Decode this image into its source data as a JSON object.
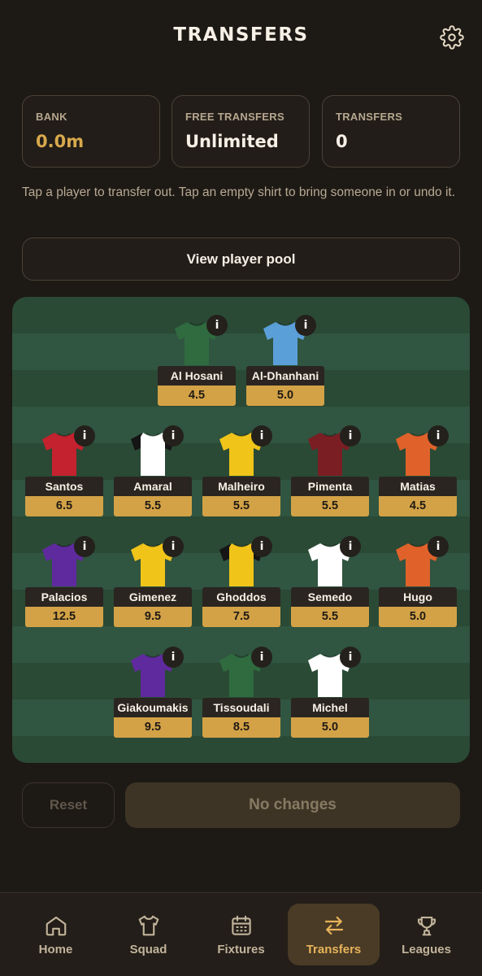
{
  "header": {
    "title": "TRANSFERS",
    "settings_icon": "gear-icon"
  },
  "stats": [
    {
      "label": "BANK",
      "value": "0.0m"
    },
    {
      "label": "FREE TRANSFERS",
      "value": "Unlimited"
    },
    {
      "label": "TRANSFERS",
      "value": "0"
    }
  ],
  "hint": "Tap a player to transfer out. Tap an empty shirt to bring someone in or undo it.",
  "pool_button": "View player pool",
  "info_glyph": "i",
  "players": [
    {
      "name": "Al Hosani",
      "price": "4.5",
      "color": "#2f6b3f",
      "sleeve": "#2f6b3f"
    },
    {
      "name": "Al-Dhanhani",
      "price": "5.0",
      "color": "#5b9fd9",
      "sleeve": "#5b9fd9"
    },
    {
      "name": "Santos",
      "price": "6.5",
      "color": "#c4222e",
      "sleeve": "#c4222e"
    },
    {
      "name": "Amaral",
      "price": "5.5",
      "color": "#ffffff",
      "sleeve": "#151515"
    },
    {
      "name": "Malheiro",
      "price": "5.5",
      "color": "#f0c419",
      "sleeve": "#f0c419"
    },
    {
      "name": "Pimenta",
      "price": "5.5",
      "color": "#7a1e24",
      "sleeve": "#7a1e24"
    },
    {
      "name": "Matias",
      "price": "4.5",
      "color": "#e0622a",
      "sleeve": "#e0622a"
    },
    {
      "name": "Palacios",
      "price": "12.5",
      "color": "#5f2a9e",
      "sleeve": "#5f2a9e"
    },
    {
      "name": "Gimenez",
      "price": "9.5",
      "color": "#f0c419",
      "sleeve": "#f0c419"
    },
    {
      "name": "Ghoddos",
      "price": "7.5",
      "color": "#f0c419",
      "sleeve": "#151515"
    },
    {
      "name": "Semedo",
      "price": "5.5",
      "color": "#ffffff",
      "sleeve": "#ffffff"
    },
    {
      "name": "Hugo",
      "price": "5.0",
      "color": "#e0622a",
      "sleeve": "#e0622a"
    },
    {
      "name": "Giakoumakis",
      "price": "9.5",
      "color": "#5f2a9e",
      "sleeve": "#5f2a9e"
    },
    {
      "name": "Tissoudali",
      "price": "8.5",
      "color": "#2f6b3f",
      "sleeve": "#2f6b3f"
    },
    {
      "name": "Michel",
      "price": "5.0",
      "color": "#ffffff",
      "sleeve": "#ffffff"
    }
  ],
  "actions": {
    "reset": "Reset",
    "confirm": "No changes"
  },
  "nav": [
    {
      "label": "Home",
      "icon": "home-icon",
      "active": false
    },
    {
      "label": "Squad",
      "icon": "shirt-icon",
      "active": false
    },
    {
      "label": "Fixtures",
      "icon": "calendar-icon",
      "active": false
    },
    {
      "label": "Transfers",
      "icon": "transfer-arrows-icon",
      "active": true
    },
    {
      "label": "Leagues",
      "icon": "trophy-icon",
      "active": false
    }
  ],
  "colors": {
    "accent": "#d3a247",
    "background": "#1d1915",
    "pitch": "#2a4a35"
  }
}
